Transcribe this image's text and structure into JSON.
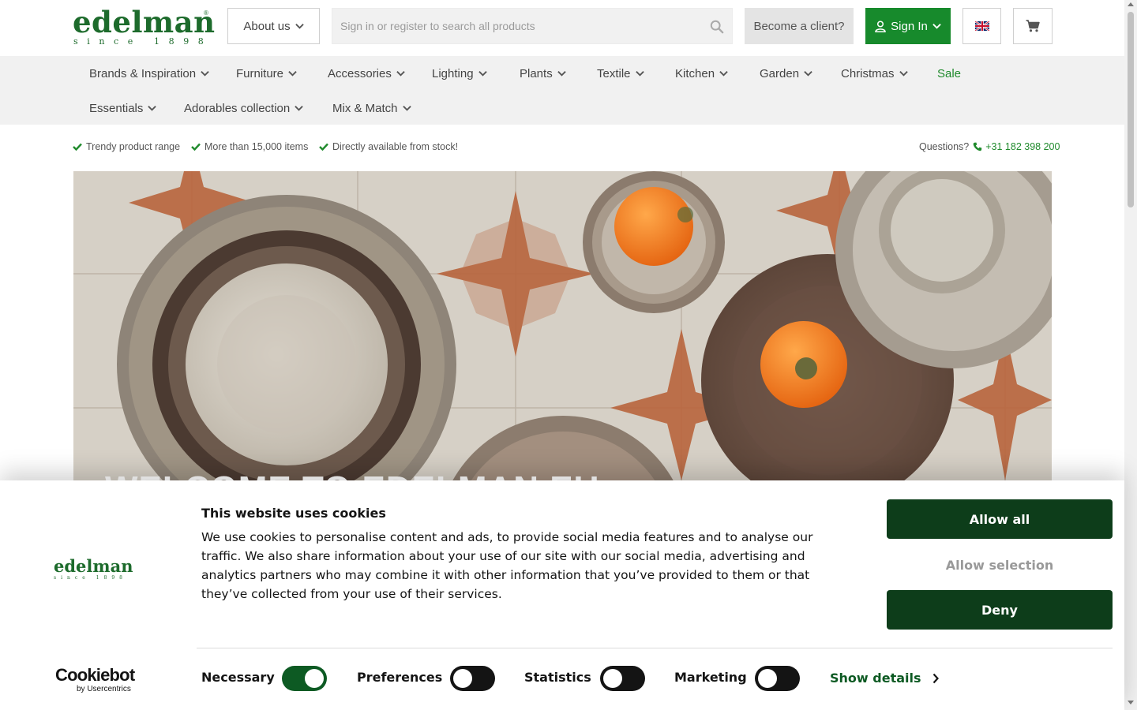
{
  "brand": {
    "name": "edelman",
    "since": "since 1898",
    "reg": "®",
    "color": "#1d6b2c"
  },
  "header": {
    "about_label": "About us",
    "search_placeholder": "Sign in or register to search all products",
    "become_client_label": "Become a client?",
    "sign_in_label": "Sign In",
    "language_icon": "uk-flag-icon",
    "cart_icon": "cart-icon"
  },
  "nav": {
    "items": [
      {
        "label": "Brands & Inspiration"
      },
      {
        "label": "Furniture"
      },
      {
        "label": "Accessories"
      },
      {
        "label": "Lighting"
      },
      {
        "label": "Plants"
      },
      {
        "label": "Textile"
      },
      {
        "label": "Kitchen"
      },
      {
        "label": "Garden"
      },
      {
        "label": "Christmas"
      },
      {
        "label": "Sale"
      },
      {
        "label": "Essentials"
      },
      {
        "label": "Adorables collection"
      },
      {
        "label": "Mix & Match"
      }
    ]
  },
  "usps": [
    "Trendy product range",
    "More than 15,000 items",
    "Directly available from stock!"
  ],
  "contact": {
    "question_label": "Questions?",
    "phone": "+31 182 398 200"
  },
  "hero": {
    "title": "WELCOME TO EDELMAN.EU"
  },
  "cookie": {
    "title": "This website uses cookies",
    "text": "We use cookies to personalise content and ads, to provide social media features and to analyse our traffic. We also share information about your use of our site with our social media, advertising and analytics partners who may combine it with other information that you’ve provided to them or that they’ve collected from your use of their services.",
    "allow_all_label": "Allow all",
    "allow_selection_label": "Allow selection",
    "deny_label": "Deny",
    "show_details_label": "Show details",
    "provider_name": "Cookiebot",
    "provider_sub": "by Usercentrics",
    "categories": [
      {
        "label": "Necessary",
        "enabled": true
      },
      {
        "label": "Preferences",
        "enabled": false
      },
      {
        "label": "Statistics",
        "enabled": false
      },
      {
        "label": "Marketing",
        "enabled": false
      }
    ],
    "button_color": "#0d3d1a"
  },
  "colors": {
    "accent_green": "#178a2c",
    "link_green": "#1f8a2c",
    "nav_bg": "#f1f1f1"
  }
}
